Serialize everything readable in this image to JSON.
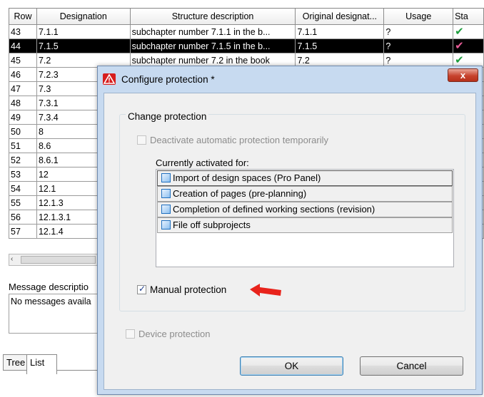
{
  "table": {
    "headers": [
      "Row",
      "Designation",
      "Structure description",
      "Original designat...",
      "Usage",
      "Sta"
    ],
    "rows": [
      {
        "row": "43",
        "designation": "7.1.1",
        "description": "subchapter number 7.1.1 in the b...",
        "original": "7.1.1",
        "usage": "?",
        "status": "check-green",
        "selected": false
      },
      {
        "row": "44",
        "designation": "7.1.5",
        "description": "subchapter number 7.1.5 in the b...",
        "original": "7.1.5",
        "usage": "?",
        "status": "check-pink",
        "selected": true
      },
      {
        "row": "45",
        "designation": "7.2",
        "description": "subchapter number 7.2 in the book",
        "original": "7.2",
        "usage": "?",
        "status": "check-green",
        "selected": false
      },
      {
        "row": "46",
        "designation": "7.2.3",
        "description": "",
        "original": "",
        "usage": "",
        "status": "",
        "selected": false
      },
      {
        "row": "47",
        "designation": "7.3",
        "description": "",
        "original": "",
        "usage": "",
        "status": "",
        "selected": false
      },
      {
        "row": "48",
        "designation": "7.3.1",
        "description": "",
        "original": "",
        "usage": "",
        "status": "",
        "selected": false
      },
      {
        "row": "49",
        "designation": "7.3.4",
        "description": "",
        "original": "",
        "usage": "",
        "status": "",
        "selected": false
      },
      {
        "row": "50",
        "designation": "8",
        "description": "",
        "original": "",
        "usage": "",
        "status": "",
        "selected": false
      },
      {
        "row": "51",
        "designation": "8.6",
        "description": "",
        "original": "",
        "usage": "",
        "status": "",
        "selected": false
      },
      {
        "row": "52",
        "designation": "8.6.1",
        "description": "",
        "original": "",
        "usage": "",
        "status": "",
        "selected": false
      },
      {
        "row": "53",
        "designation": "12",
        "description": "",
        "original": "",
        "usage": "",
        "status": "",
        "selected": false
      },
      {
        "row": "54",
        "designation": "12.1",
        "description": "",
        "original": "",
        "usage": "",
        "status": "",
        "selected": false
      },
      {
        "row": "55",
        "designation": "12.1.3",
        "description": "",
        "original": "",
        "usage": "",
        "status": "",
        "selected": false
      },
      {
        "row": "56",
        "designation": "12.1.3.1",
        "description": "",
        "original": "",
        "usage": "",
        "status": "",
        "selected": false
      },
      {
        "row": "57",
        "designation": "12.1.4",
        "description": "",
        "original": "",
        "usage": "",
        "status": "",
        "selected": false
      }
    ]
  },
  "scrollbar": {
    "left_arrow": "‹"
  },
  "messages": {
    "label": "Message descriptio",
    "text": "No messages availa"
  },
  "bottom_tabs": {
    "tree": "Tree",
    "list": "List"
  },
  "dialog": {
    "title": "Configure protection *",
    "close_label": "x",
    "group_title": "Change protection",
    "deactivate_label": "Deactivate automatic protection temporarily",
    "deactivate_checked": false,
    "activated_for_label": "Currently activated for:",
    "activated_items": [
      "Import of design spaces (Pro Panel)",
      "Creation of pages (pre-planning)",
      "Completion of defined working sections (revision)",
      "File off subprojects"
    ],
    "manual_label": "Manual protection",
    "manual_checked": true,
    "device_label": "Device protection",
    "device_checked": false,
    "ok_label": "OK",
    "cancel_label": "Cancel"
  },
  "colors": {
    "selected_row_bg": "#000000",
    "check_green": "#1c9d3c",
    "check_pink": "#e85c97",
    "annotation_arrow": "#e8231b",
    "dialog_frame": "#c7daf0"
  }
}
